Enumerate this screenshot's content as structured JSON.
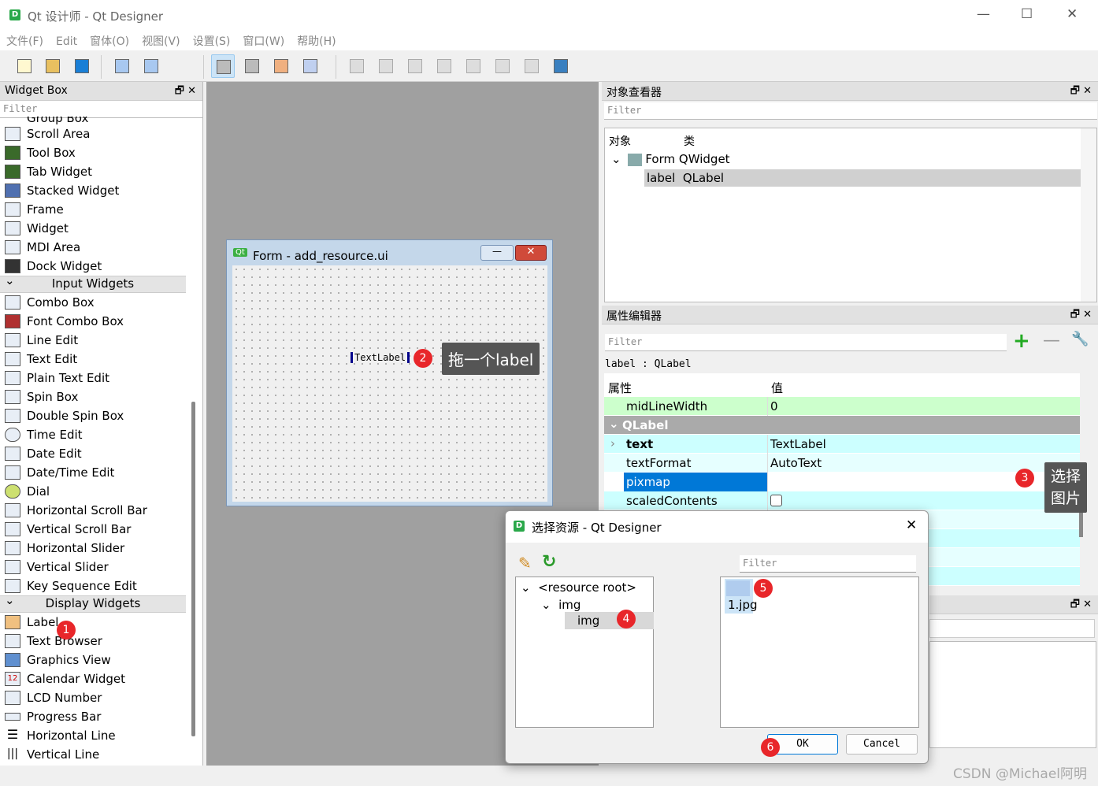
{
  "window": {
    "title": "Qt 设计师 - Qt Designer",
    "logo": "D",
    "minimize": "—",
    "maximize": "☐",
    "close": "✕"
  },
  "menu": [
    "文件(F)",
    "Edit",
    "窗体(O)",
    "视图(V)",
    "设置(S)",
    "窗口(W)",
    "帮助(H)"
  ],
  "toolbar_icons": [
    "new-file-icon",
    "open-folder-icon",
    "save-icon",
    "send-to-back-icon",
    "bring-to-front-icon",
    "edit-widgets-icon",
    "edit-signals-slots-icon",
    "edit-buddies-icon",
    "edit-tab-order-icon",
    "layout-horizontal-icon",
    "layout-vertical-icon",
    "layout-horizontal-splitter-icon",
    "layout-vertical-splitter-icon",
    "layout-grid-icon",
    "layout-form-icon",
    "break-layout-icon",
    "adjust-size-icon"
  ],
  "widget_box": {
    "title": "Widget Box",
    "filter_placeholder": "Filter",
    "partial_item": "Group Box",
    "containers": [
      "Scroll Area",
      "Tool Box",
      "Tab Widget",
      "Stacked Widget",
      "Frame",
      "Widget",
      "MDI Area",
      "Dock Widget"
    ],
    "input_title": "Input Widgets",
    "input": [
      "Combo Box",
      "Font Combo Box",
      "Line Edit",
      "Text Edit",
      "Plain Text Edit",
      "Spin Box",
      "Double Spin Box",
      "Time Edit",
      "Date Edit",
      "Date/Time Edit",
      "Dial",
      "Horizontal Scroll Bar",
      "Vertical Scroll Bar",
      "Horizontal Slider",
      "Vertical Slider",
      "Key Sequence Edit"
    ],
    "display_title": "Display Widgets",
    "display": [
      "Label",
      "Text Browser",
      "Graphics View",
      "Calendar Widget",
      "LCD Number",
      "Progress Bar",
      "Horizontal Line",
      "Vertical Line"
    ]
  },
  "form": {
    "title": "Form - add_resource.ui",
    "logo": "Qt",
    "label_text": "TextLabel"
  },
  "annotations": {
    "b1": "1",
    "b2": "2",
    "t2": "拖一个label",
    "b3": "3",
    "t3a": "选择",
    "t3b": "图片",
    "b4": "4",
    "b5": "5",
    "b6": "6"
  },
  "object_inspector": {
    "title": "对象查看器",
    "filter_placeholder": "Filter",
    "col_object": "对象",
    "col_class": "类",
    "rows": [
      {
        "object": "Form",
        "class": "QWidget"
      },
      {
        "object": "label",
        "class": "QLabel"
      }
    ]
  },
  "property_editor": {
    "title": "属性编辑器",
    "filter_placeholder": "Filter",
    "context": "label : QLabel",
    "col_prop": "属性",
    "col_value": "值",
    "rows": [
      {
        "name": "midLineWidth",
        "value": "0"
      },
      {
        "name": "QLabel",
        "value": ""
      },
      {
        "name": "text",
        "value": "TextLabel"
      },
      {
        "name": "textFormat",
        "value": "AutoText"
      },
      {
        "name": "pixmap",
        "value": ""
      },
      {
        "name": "scaledContents",
        "value": ""
      }
    ]
  },
  "dialog": {
    "title": "选择资源 - Qt Designer",
    "close": "✕",
    "filter_placeholder": "Filter",
    "tree": [
      "<resource root>",
      "img",
      "img"
    ],
    "file": "1.jpg",
    "ok": "OK",
    "cancel": "Cancel"
  },
  "watermark": "CSDN @Michael阿明",
  "colors": {
    "accent_selection": "#0078d7",
    "property_green": "#ccffcc",
    "property_cyan": "#ccffff",
    "badge": "#e8262a"
  }
}
